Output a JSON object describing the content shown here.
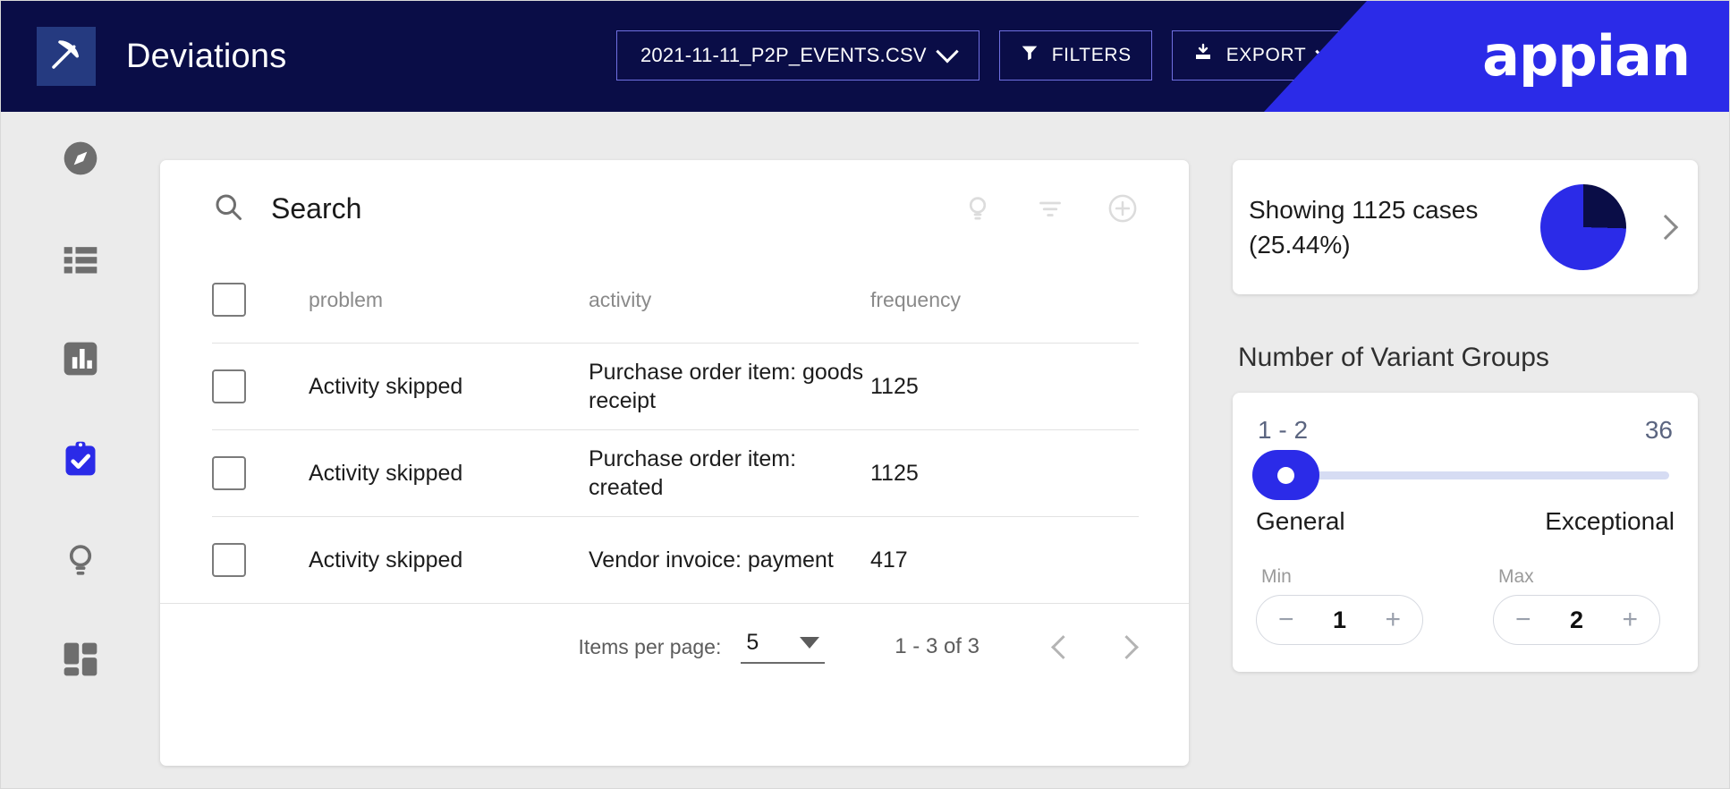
{
  "header": {
    "logo_icon": "pickaxe-icon",
    "title": "Deviations",
    "file_selector": {
      "label": "2021-11-11_P2P_EVENTS.CSV",
      "icon": "chevron-down-icon"
    },
    "filters_button": {
      "label": "FILTERS",
      "icon": "filter-icon"
    },
    "export_button": {
      "label": "EXPORT",
      "icon": "download-icon",
      "caret": "chevron-down-icon"
    },
    "brand": "appian",
    "colors": {
      "bar": "#0a0d47",
      "brand": "#2b2be8",
      "border": "#6f6fe0",
      "logo_box": "#253a80"
    }
  },
  "sidebar": {
    "items": [
      {
        "name": "compass-icon",
        "active": false
      },
      {
        "name": "list-icon",
        "active": false
      },
      {
        "name": "bar-chart-icon",
        "active": false
      },
      {
        "name": "clipboard-check-icon",
        "active": true
      },
      {
        "name": "lightbulb-icon",
        "active": false
      },
      {
        "name": "grid-icon",
        "active": false
      }
    ],
    "active_color": "#2b2be8",
    "inactive_color": "#6e6e6e"
  },
  "search": {
    "placeholder": "Search",
    "value": "",
    "icon": "search-icon",
    "actions": [
      {
        "name": "lightbulb-icon"
      },
      {
        "name": "sort-icon"
      },
      {
        "name": "add-circle-icon"
      }
    ]
  },
  "table": {
    "columns": [
      "problem",
      "activity",
      "frequency"
    ],
    "rows": [
      {
        "problem": "Activity skipped",
        "activity": "Purchase order item: goods receipt",
        "frequency": "1125"
      },
      {
        "problem": "Activity skipped",
        "activity": "Purchase order item: created",
        "frequency": "1125"
      },
      {
        "problem": "Activity skipped",
        "activity": "Vendor invoice: payment",
        "frequency": "417"
      }
    ]
  },
  "pagination": {
    "items_per_page_label": "Items per page:",
    "items_per_page_value": "5",
    "range": "1 - 3 of 3",
    "prev_icon": "chevron-left-icon",
    "next_icon": "chevron-right-icon"
  },
  "cases_card": {
    "line1": "Showing 1125 cases",
    "line2": "(25.44%)",
    "chevron": "chevron-right-icon",
    "pie": {
      "percent": 25.44,
      "slice_color": "#0a0d47",
      "rest_color": "#2b2be8"
    }
  },
  "variant_groups": {
    "title": "Number of Variant Groups",
    "selected_range": "1 - 2",
    "max_value": "36",
    "left_label": "General",
    "right_label": "Exceptional",
    "min": {
      "label": "Min",
      "value": "1",
      "minus": "−",
      "plus": "+"
    },
    "max": {
      "label": "Max",
      "value": "2",
      "minus": "−",
      "plus": "+"
    }
  }
}
